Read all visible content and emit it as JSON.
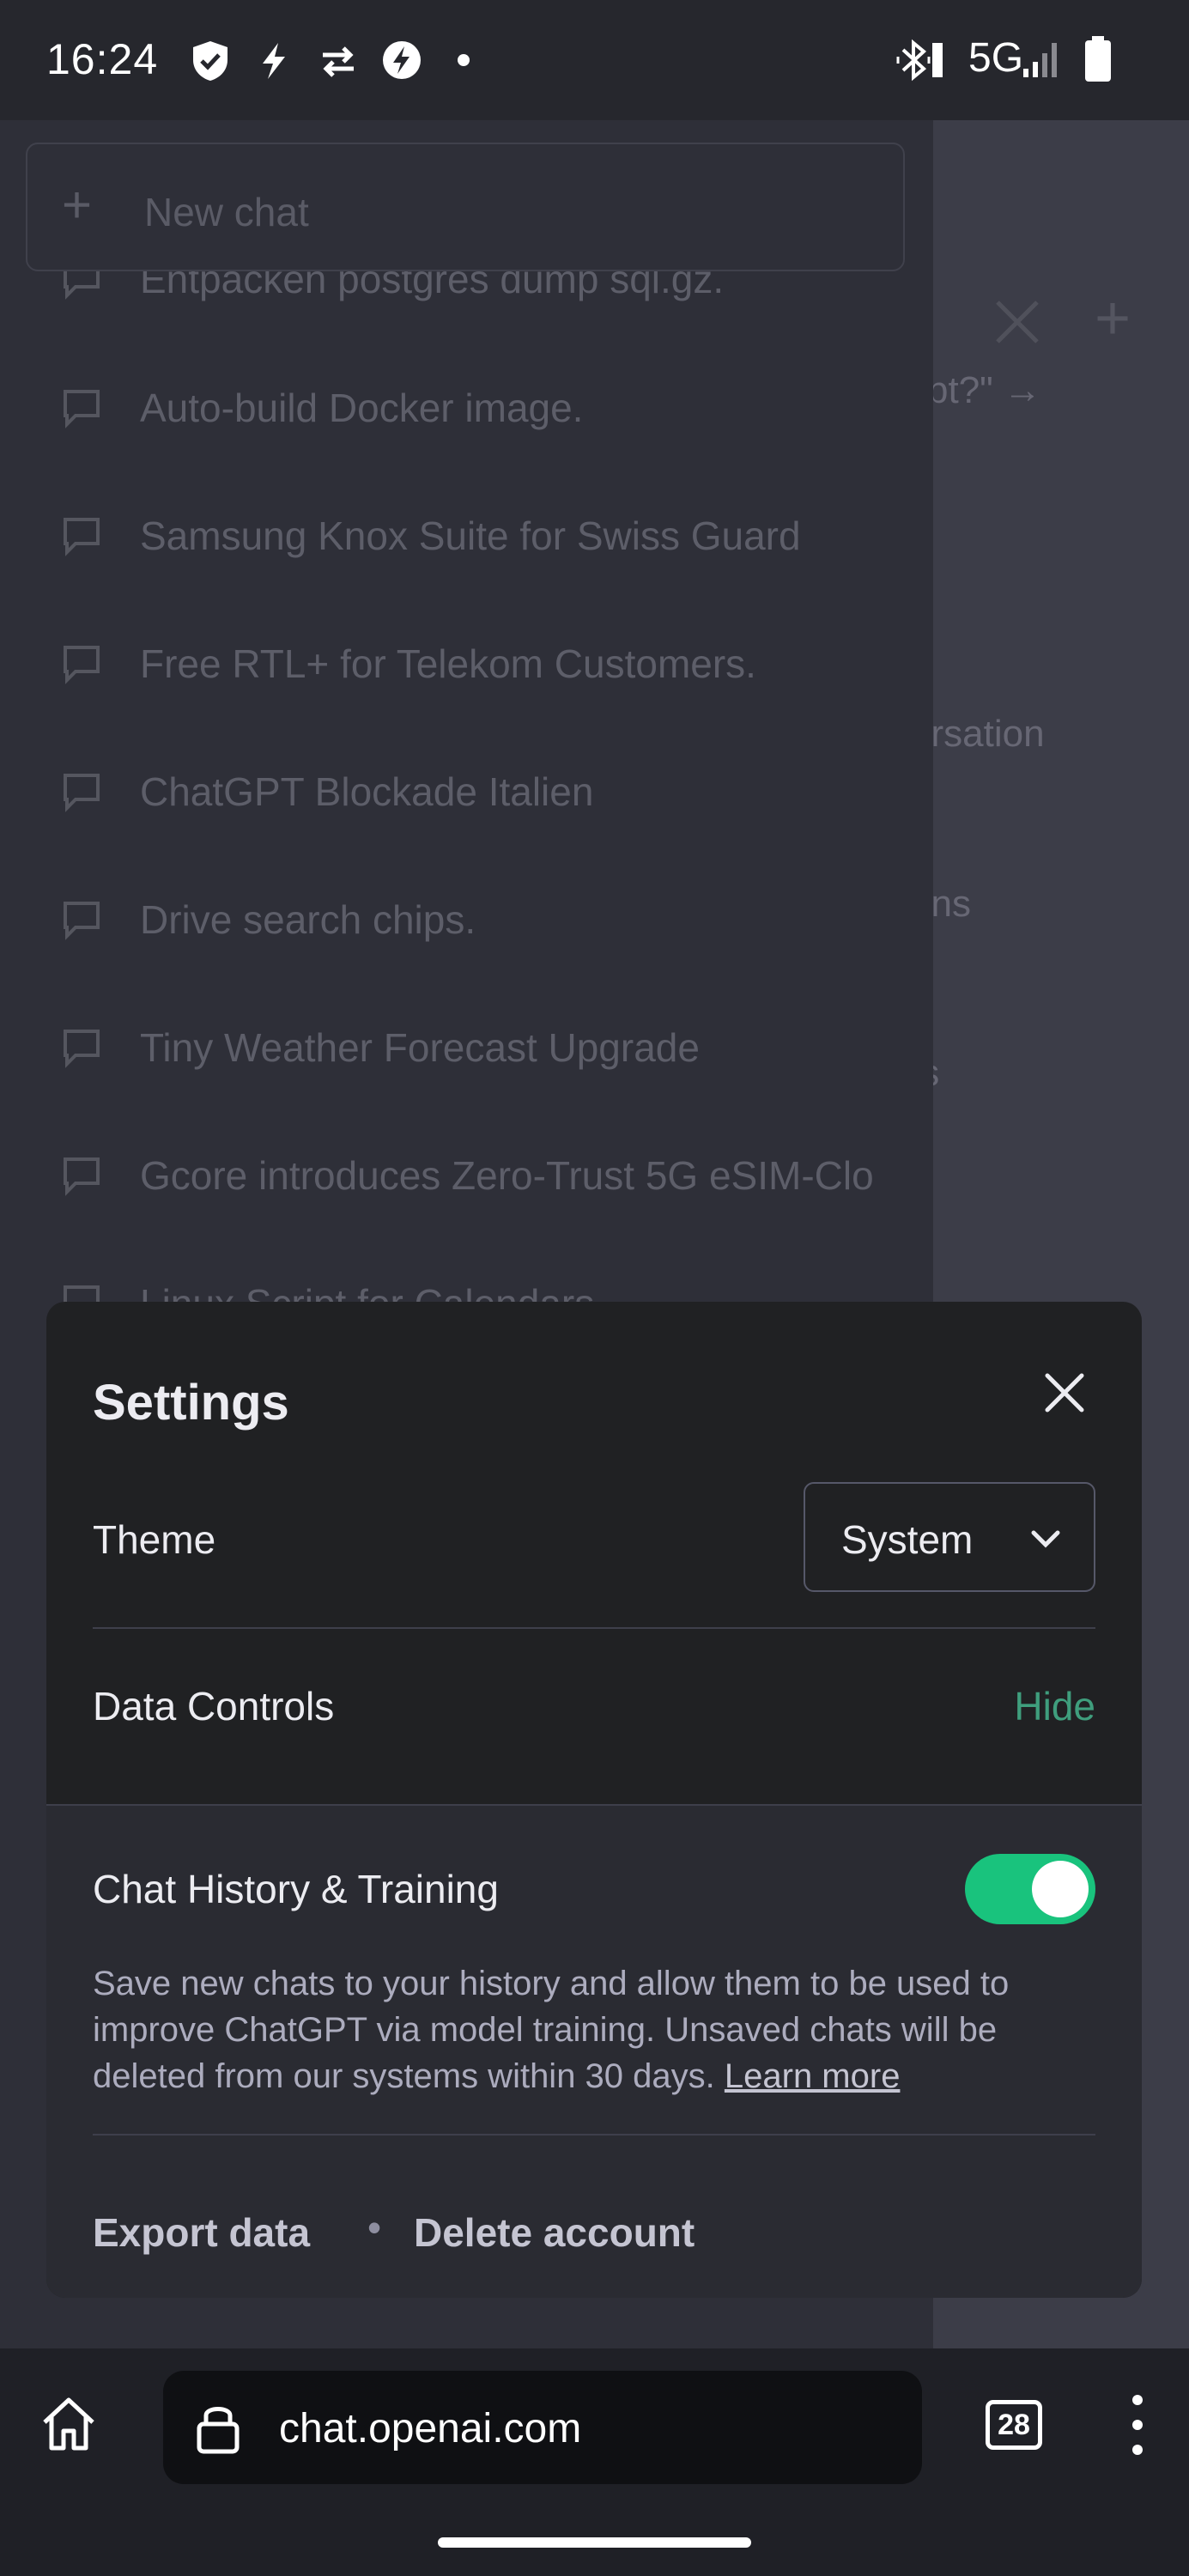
{
  "status_bar": {
    "time": "16:24",
    "network": "5G",
    "icons": [
      "shield-check-icon",
      "flash-icon",
      "transfer-arrows-icon",
      "bolt-circle-icon",
      "dot-icon",
      "bluetooth-vibrate-icon",
      "signal-icon",
      "battery-icon"
    ]
  },
  "sidebar": {
    "new_chat_label": "New chat",
    "history": [
      {
        "label": "Entpacken postgres dump sql.gz."
      },
      {
        "label": "Auto-build Docker image."
      },
      {
        "label": "Samsung Knox Suite for Swiss Guard"
      },
      {
        "label": "Free RTL+ for Telekom Customers."
      },
      {
        "label": "ChatGPT Blockade Italien"
      },
      {
        "label": "Drive search chips."
      },
      {
        "label": "Tiny Weather Forecast Upgrade"
      },
      {
        "label": "Gcore introduces Zero-Trust 5G eSIM-Clo"
      },
      {
        "label": "Linux Script for Calendars"
      }
    ]
  },
  "background_page": {
    "fragments": [
      "pt?\" →",
      "ersation",
      "ons",
      "ts"
    ]
  },
  "settings": {
    "title": "Settings",
    "theme_label": "Theme",
    "theme_value": "System",
    "data_controls_label": "Data Controls",
    "data_controls_action": "Hide",
    "chat_history_label": "Chat History & Training",
    "chat_history_enabled": true,
    "description": "Save new chats to your history and allow them to be used to improve ChatGPT via model training. Unsaved chats will be deleted from our systems within 30 days.",
    "learn_more": "Learn more",
    "export_label": "Export data",
    "separator": "•",
    "delete_label": "Delete account"
  },
  "browser": {
    "url": "chat.openai.com",
    "tab_count": "28"
  },
  "colors": {
    "accent_green": "#19c37d",
    "link_green": "#3f9e7d",
    "modal_bg": "#202123"
  }
}
